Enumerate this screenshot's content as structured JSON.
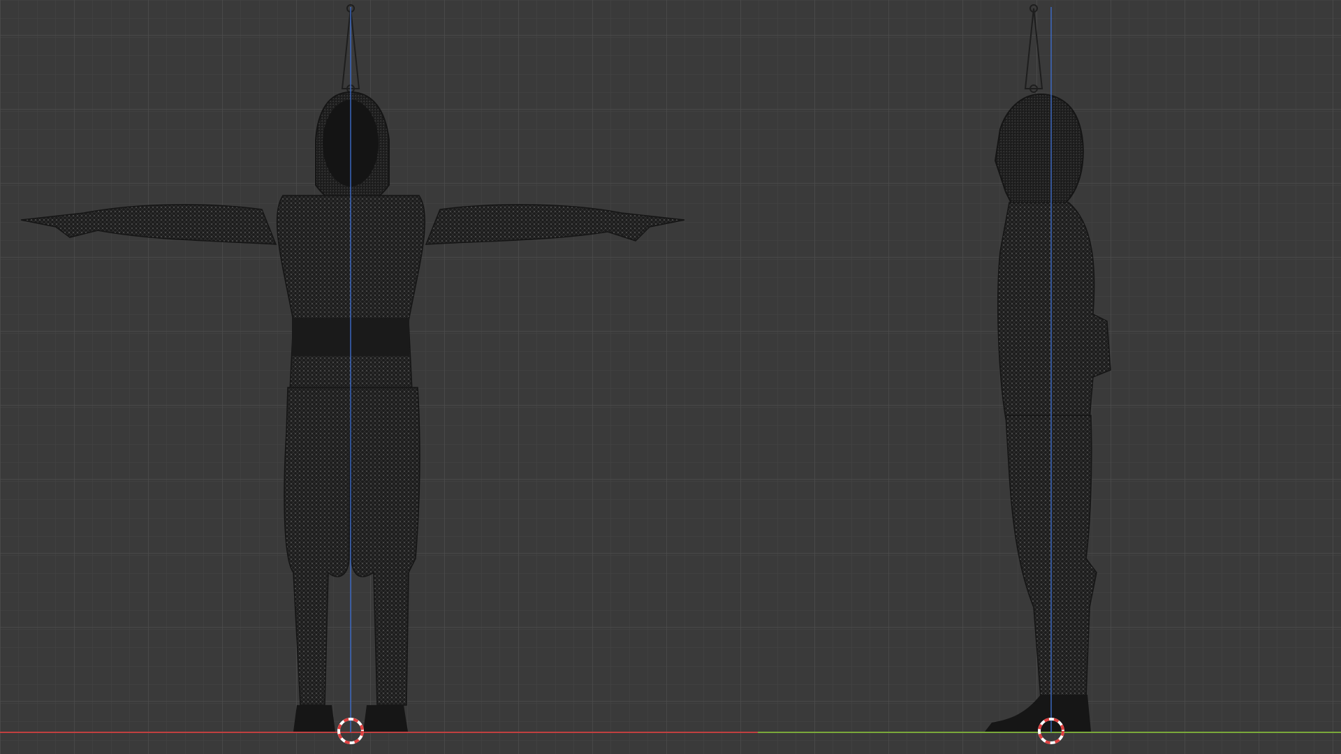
{
  "viewports": [
    {
      "id": "front",
      "view": "front",
      "ground_axis_color": "#c04040",
      "vertical_axis_color": "#3f6fd0"
    },
    {
      "id": "side",
      "view": "side",
      "ground_axis_color": "#7aa83a",
      "vertical_axis_color": "#3f6fd0"
    }
  ],
  "colors": {
    "background": "#3a3a3a",
    "grid_minor": "#454545",
    "grid_major": "#4d4d4d",
    "mesh_fill": "#1c1c1c",
    "mesh_wire": "#303030",
    "vertex_dots": "#9a9a9a",
    "bone": "#1e1e1e",
    "cursor_red": "#e04040",
    "cursor_white": "#ffffff"
  },
  "icons": [
    "3d-cursor-icon",
    "armature-bone-icon"
  ]
}
